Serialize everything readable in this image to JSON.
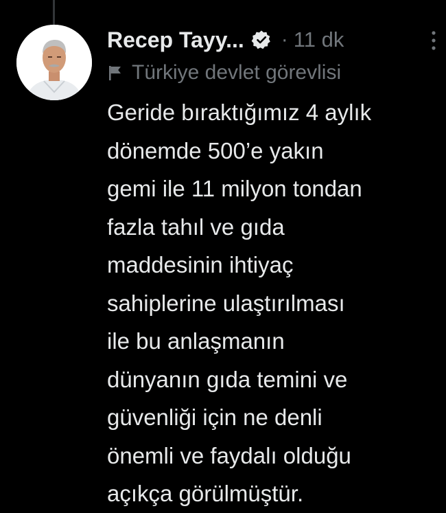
{
  "tweet": {
    "author_name": "Recep Tayy...",
    "separator": "·",
    "timestamp": "11 dk",
    "affiliation_label": "Türkiye devlet görevlisi",
    "text_lines": [
      "Geride bıraktığımız 4 aylık",
      "dönemde 500’e yakın",
      "gemi ile 11 milyon tondan",
      "fazla tahıl ve gıda",
      "maddesinin ihtiyaç",
      "sahiplerine ulaştırılması",
      "ile bu anlaşmanın",
      "dünyanın gıda temini ve",
      "güvenliği için ne denli",
      "önemli ve faydalı olduğu",
      "açıkça görülmüştür."
    ]
  },
  "icons": {
    "verified": "verified-badge-icon",
    "more": "more-options-icon",
    "affiliation": "flag-icon"
  },
  "colors": {
    "background": "#000000",
    "primary_text": "#e7e9ea",
    "secondary_text": "#71767b",
    "thread_line": "#333639"
  }
}
